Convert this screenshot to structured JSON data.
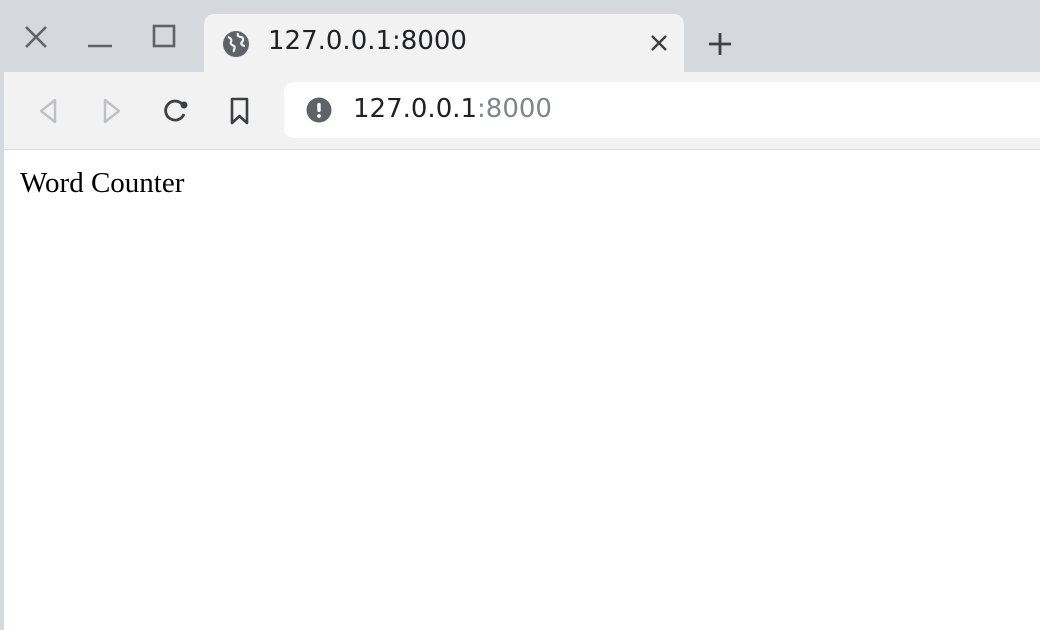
{
  "browser": {
    "tab": {
      "title": "127.0.0.1:8000",
      "icon": "globe-icon"
    },
    "address": {
      "host": "127.0.0.1",
      "port": ":8000",
      "icon": "info-icon"
    },
    "colors": {
      "tabstrip": "#d5d8dc",
      "toolbar": "#f2f2f2",
      "icon": "#5f6368"
    }
  },
  "page": {
    "text": "Word Counter"
  }
}
